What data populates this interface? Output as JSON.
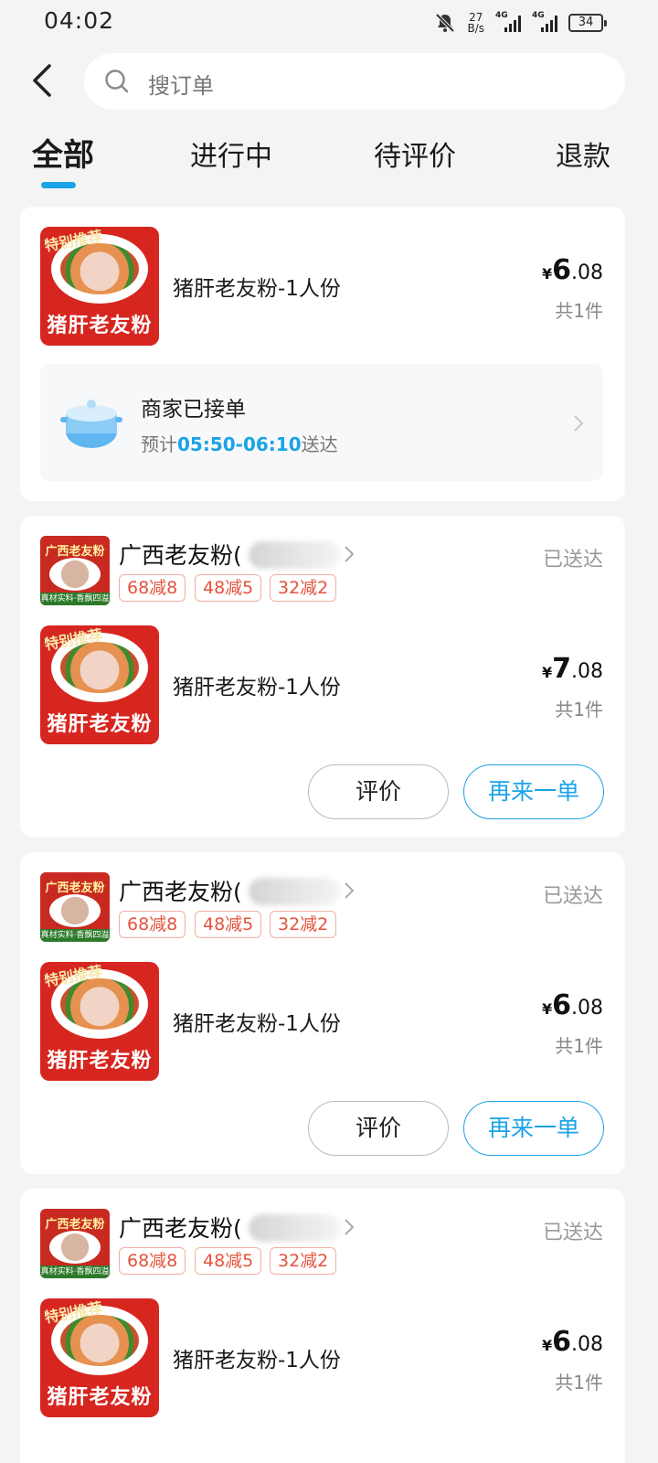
{
  "status_bar": {
    "time": "04:02",
    "net_speed_value": "27",
    "net_speed_unit": "B/s",
    "signal_label_1": "4G",
    "signal_label_2": "4G",
    "battery": "34",
    "icons": [
      "bell-muted-icon",
      "signal-icon",
      "battery-icon"
    ]
  },
  "header": {
    "search_placeholder": "搜订单"
  },
  "tabs": [
    {
      "label": "全部",
      "active": true
    },
    {
      "label": "进行中"
    },
    {
      "label": "待评价"
    },
    {
      "label": "退款"
    }
  ],
  "colors": {
    "accent": "#1ba3e6",
    "promo": "#e5533c",
    "brand_red": "#d6261f"
  },
  "orders": [
    {
      "thumb_badge": "特别推荐",
      "thumb_title": "猪肝老友粉",
      "item_name": "猪肝老友粉-1人份",
      "price_symbol": "¥",
      "price_int": "6",
      "price_dec": ".08",
      "qty": "共1件",
      "eta_title": "商家已接单",
      "eta_prefix": "预计",
      "eta_time": "05:50-06:10",
      "eta_suffix": "送达"
    },
    {
      "shop_name": "广西老友粉(",
      "shop_logo_title": "广西老友粉",
      "shop_logo_foot": "真材实料·香飘四溢",
      "status": "已送达",
      "promos": [
        "68减8",
        "48减5",
        "32减2"
      ],
      "thumb_badge": "特别推荐",
      "thumb_title": "猪肝老友粉",
      "item_name": "猪肝老友粉-1人份",
      "price_symbol": "¥",
      "price_int": "7",
      "price_dec": ".08",
      "qty": "共1件",
      "review_label": "评价",
      "reorder_label": "再来一单"
    },
    {
      "shop_name": "广西老友粉(",
      "shop_logo_title": "广西老友粉",
      "shop_logo_foot": "真材实料·香飘四溢",
      "status": "已送达",
      "promos": [
        "68减8",
        "48减5",
        "32减2"
      ],
      "thumb_badge": "特别推荐",
      "thumb_title": "猪肝老友粉",
      "item_name": "猪肝老友粉-1人份",
      "price_symbol": "¥",
      "price_int": "6",
      "price_dec": ".08",
      "qty": "共1件",
      "review_label": "评价",
      "reorder_label": "再来一单"
    },
    {
      "shop_name": "广西老友粉(",
      "shop_logo_title": "广西老友粉",
      "shop_logo_foot": "真材实料·香飘四溢",
      "status": "已送达",
      "promos": [
        "68减8",
        "48减5",
        "32减2"
      ],
      "thumb_badge": "特别推荐",
      "thumb_title": "猪肝老友粉",
      "item_name": "猪肝老友粉-1人份",
      "price_symbol": "¥",
      "price_int": "6",
      "price_dec": ".08",
      "qty": "共1件"
    }
  ]
}
